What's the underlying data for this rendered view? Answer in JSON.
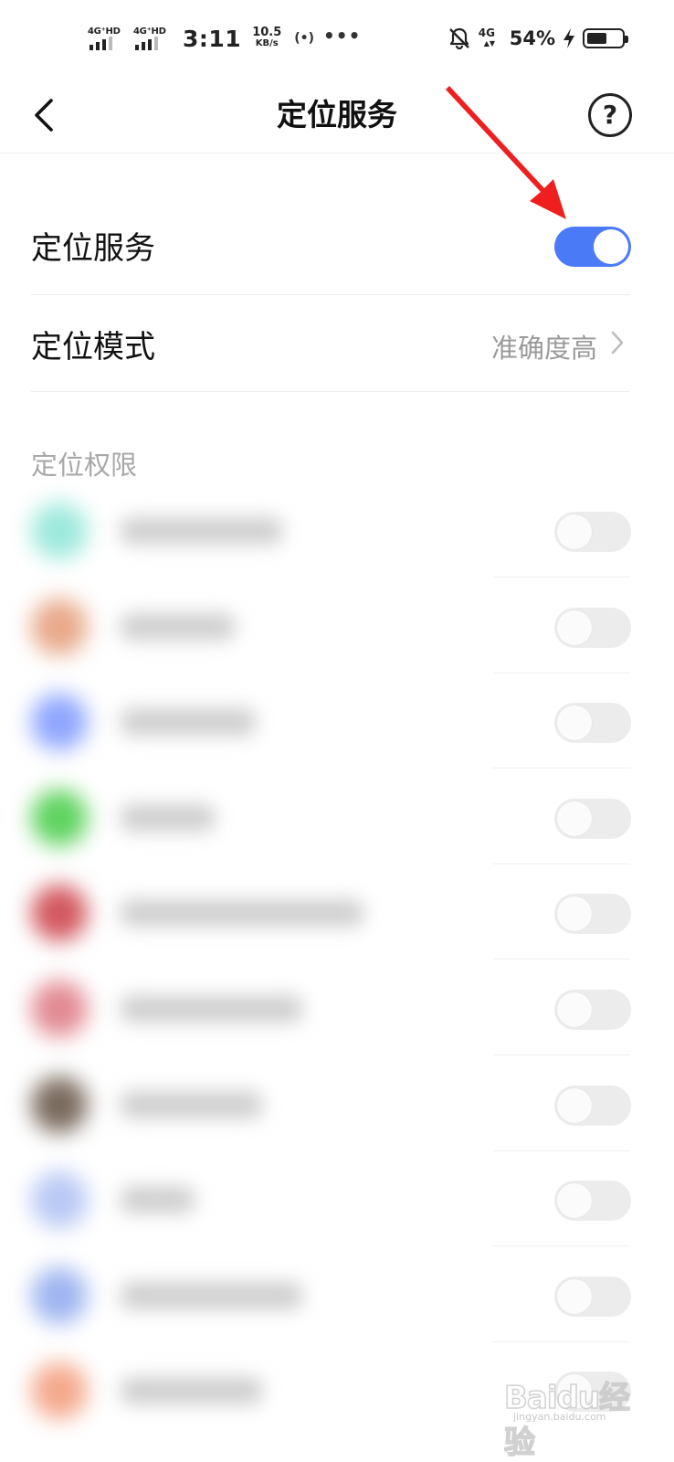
{
  "status_bar": {
    "sim1_tag": "4G⁺HD",
    "sim2_tag": "4G⁺HD",
    "time": "3:11",
    "net_speed_value": "10.5",
    "net_speed_unit": "KB/s",
    "hotspot_glyph": "(•)",
    "more_glyph": "•••",
    "network_type": "4G",
    "battery_percent": "54%",
    "battery_level": 0.54,
    "icons": [
      "signal-icon",
      "signal-icon",
      "hotspot-icon",
      "more-dots-icon",
      "mute-bell-icon",
      "network-4g-icon",
      "charging-icon",
      "battery-icon"
    ]
  },
  "header": {
    "title": "定位服务",
    "back_icon": "chevron-left-icon",
    "help_label": "?"
  },
  "settings": {
    "location_service": {
      "label": "定位服务",
      "enabled": true
    },
    "location_mode": {
      "label": "定位模式",
      "value": "准确度高"
    }
  },
  "permissions": {
    "section_title": "定位权限",
    "apps": [
      {
        "icon_color": "#9de9dc",
        "name_width_frac": 0.24,
        "enabled": false
      },
      {
        "icon_color": "#e8a98a",
        "name_width_frac": 0.17,
        "enabled": false
      },
      {
        "icon_color": "#8fa6ff",
        "name_width_frac": 0.2,
        "enabled": false
      },
      {
        "icon_color": "#5fd35f",
        "name_width_frac": 0.14,
        "enabled": false
      },
      {
        "icon_color": "#d2585f",
        "name_width_frac": 0.36,
        "enabled": false
      },
      {
        "icon_color": "#e28a93",
        "name_width_frac": 0.27,
        "enabled": false
      },
      {
        "icon_color": "#7a6a5e",
        "name_width_frac": 0.21,
        "enabled": false
      },
      {
        "icon_color": "#b9c8f5",
        "name_width_frac": 0.11,
        "enabled": false
      },
      {
        "icon_color": "#9fb5f0",
        "name_width_frac": 0.27,
        "enabled": false
      },
      {
        "icon_color": "#f4a98d",
        "name_width_frac": 0.21,
        "enabled": false
      }
    ]
  },
  "annotation": {
    "color": "#f01f1f"
  },
  "watermark": {
    "logo": "Baidu经验",
    "url": "jingyan.baidu.com"
  },
  "colors": {
    "accent": "#4a7af6",
    "toggle_off": "#ececec",
    "secondary_text": "#9a9a9a"
  }
}
